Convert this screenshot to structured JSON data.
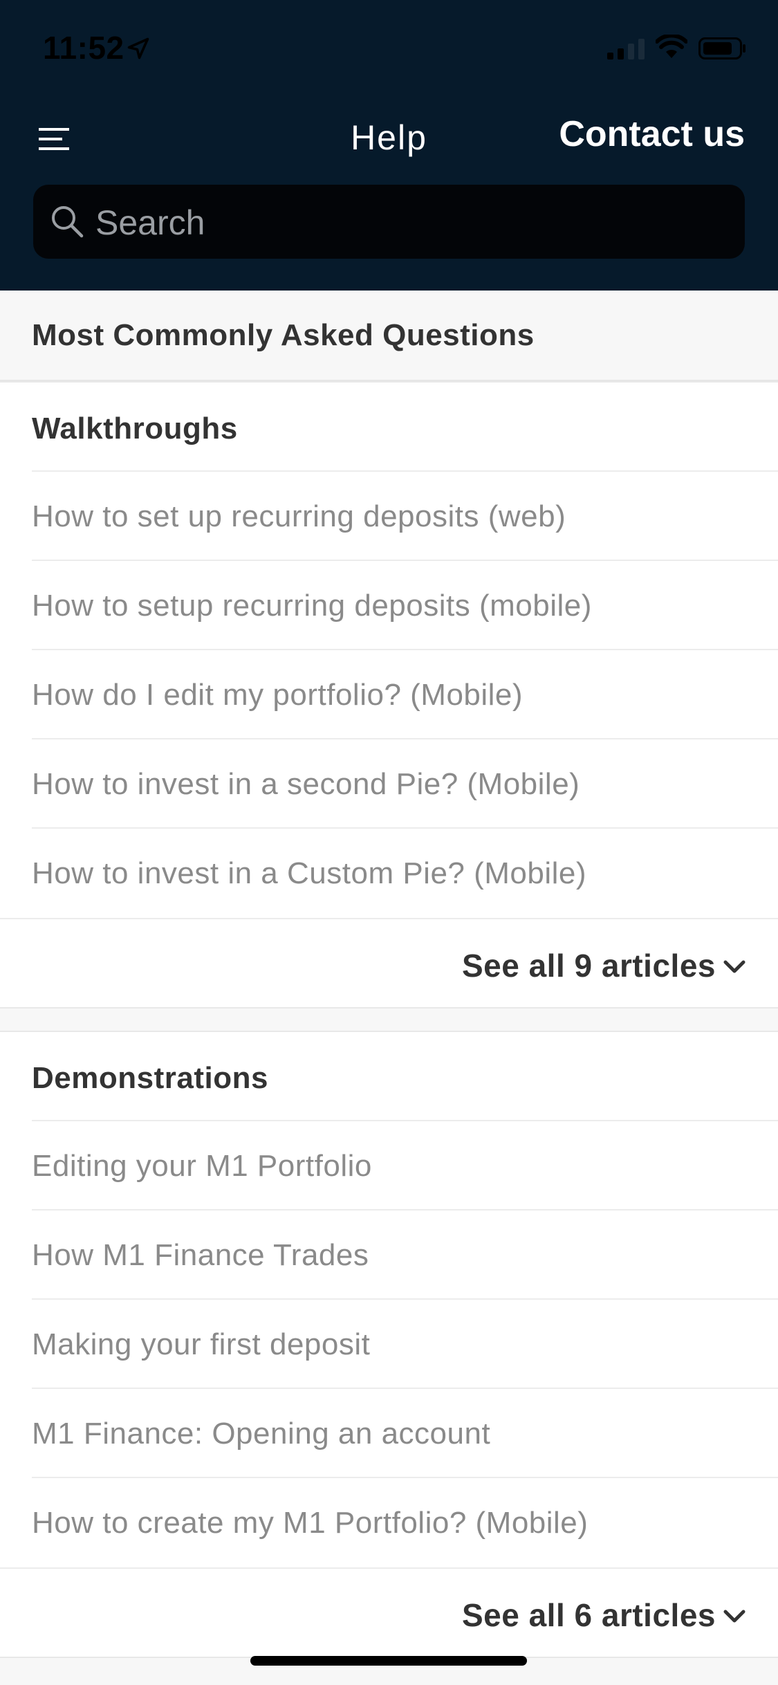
{
  "status_bar": {
    "time": "11:52"
  },
  "header": {
    "title": "Help",
    "contact_label": "Contact us",
    "search_placeholder": "Search"
  },
  "section_heading": "Most Commonly Asked Questions",
  "walkthroughs": {
    "title": "Walkthroughs",
    "articles": [
      "How to set up recurring deposits (web)",
      "How to setup recurring deposits (mobile)",
      "How do I edit my portfolio? (Mobile)",
      "How to invest in a second Pie? (Mobile)",
      "How to invest in a Custom Pie? (Mobile)"
    ],
    "see_all_label": "See all 9 articles"
  },
  "demonstrations": {
    "title": "Demonstrations",
    "articles": [
      "Editing your M1 Portfolio",
      "How M1 Finance Trades",
      "Making your first deposit",
      "M1 Finance: Opening an account",
      "How to create my M1 Portfolio? (Mobile)"
    ],
    "see_all_label": "See all 6 articles"
  },
  "colors": {
    "header_bg": "#061a2b",
    "search_bg": "#030508",
    "heading_text": "#333333",
    "article_text": "#8a8a8a"
  },
  "icons": {
    "menu": "hamburger-menu-icon",
    "search": "search-icon",
    "chevron": "chevron-down-icon"
  }
}
